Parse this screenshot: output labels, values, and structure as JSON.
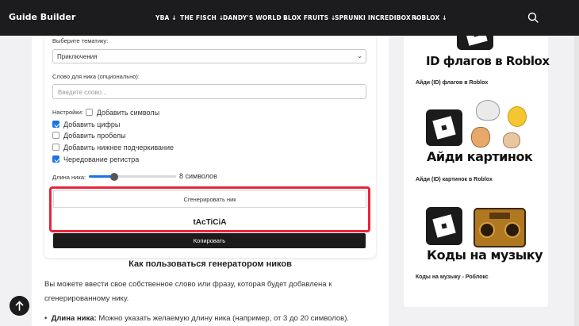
{
  "header": {
    "logo": "Guide Builder",
    "nav": [
      {
        "label": "YBA ↓"
      },
      {
        "label": "THE FISCH ↓"
      },
      {
        "label": "DANDY'S WORLD ↓"
      },
      {
        "label": "BLOX FRUITS ↓"
      },
      {
        "label": "SPRUNKI INCREDIBOX ↓"
      },
      {
        "label": "ROBLOX ↓"
      }
    ],
    "search_icon": "search-icon"
  },
  "form": {
    "theme_label": "Выберите тематику:",
    "theme_value": "Приключения",
    "word_label": "Слово для ника (опционально):",
    "word_placeholder": "Введите слово...",
    "settings_label": "Настройки:",
    "options": [
      {
        "label": "Добавить символы",
        "checked": false
      },
      {
        "label": "Добавить цифры",
        "checked": true
      },
      {
        "label": "Добавить пробелы",
        "checked": false
      },
      {
        "label": "Добавить нижнее подчеркивание",
        "checked": false
      },
      {
        "label": "Чередование регистра",
        "checked": true
      }
    ],
    "length_label": "Длина ника:",
    "length_value": "8 символов",
    "length_min": 3,
    "length_max": 20,
    "length_current": 8,
    "generate_label": "Сгенерировать ник",
    "result": "tAcTiCiA",
    "copy_label": "Копировать"
  },
  "article": {
    "title": "Как пользоваться генератором ников",
    "paragraph": "Вы можете ввести свое собственное слово или фразу, которая будет добавлена к сгенерированному нику.",
    "bullet_bold": "Длина ника:",
    "bullet_text": " Можно указать желаемую длину ника (например, от 3 до 20 символов)."
  },
  "sidebar": {
    "items": [
      {
        "image_title": "ID флагов в Roblox",
        "caption": "Айди (ID) флагов в Roblox"
      },
      {
        "image_title": "Айди картинок",
        "caption": "Айди (ID) картинок в Roblox"
      },
      {
        "image_title": "Коды на музыку",
        "caption": "Коды на музыку - Роблокс"
      }
    ]
  },
  "colors": {
    "header_bg": "#1c1c1e",
    "accent": "#1a73e8",
    "highlight": "#e8253b"
  }
}
